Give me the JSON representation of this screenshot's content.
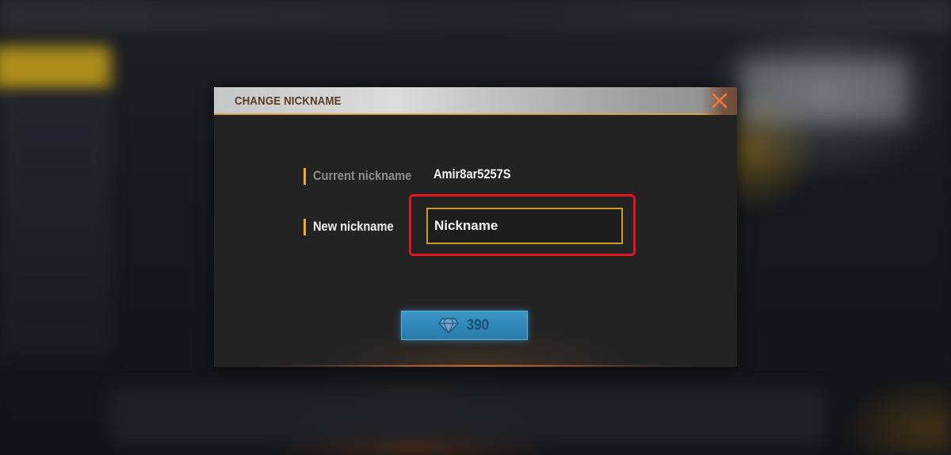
{
  "dialog": {
    "title": "CHANGE NICKNAME",
    "close_icon": "close-x-icon",
    "current_nickname_label": "Current nickname",
    "current_nickname_value": "Amir8ar5257S",
    "new_nickname_label": "New nickname",
    "new_nickname_placeholder": "Nickname",
    "new_nickname_value": "",
    "buy_button": {
      "icon": "diamond-icon",
      "price": "390"
    }
  },
  "colors": {
    "accent": "#f0a92a",
    "highlight": "#e3141b",
    "button": "#2f86b8",
    "close": "#f07a3a"
  }
}
